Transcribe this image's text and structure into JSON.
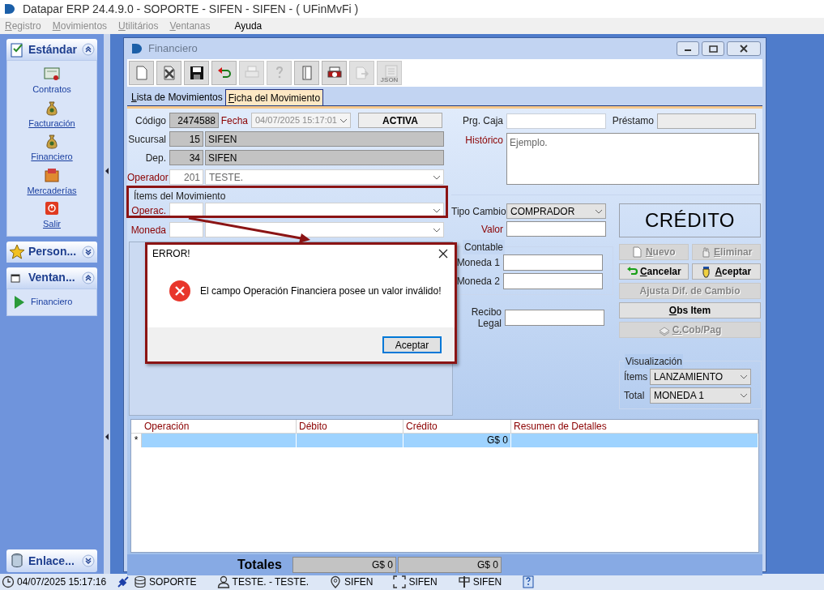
{
  "app_title": "Datapar ERP 24.4.9.0 - SOPORTE - SIFEN - SIFEN -  ( UFinMvFi )",
  "menu": [
    {
      "label": "Registro",
      "disabled": true
    },
    {
      "label": "Movimientos",
      "disabled": true
    },
    {
      "label": "Utilitários",
      "disabled": true
    },
    {
      "label": "Ventanas",
      "disabled": true
    },
    {
      "label": "Ayuda",
      "disabled": false
    }
  ],
  "sidebar": {
    "groups": [
      {
        "title": "Estándar",
        "expanded": true,
        "items": [
          {
            "label": "Contratos",
            "underlined": false
          },
          {
            "label": "Facturación",
            "underlined": true
          },
          {
            "label": "Financiero",
            "underlined": true
          },
          {
            "label": "Mercaderías",
            "underlined": true
          },
          {
            "label": "Salir",
            "underlined": true
          }
        ]
      },
      {
        "title": "Person...",
        "expanded": false
      },
      {
        "title": "Ventan...",
        "expanded": true,
        "items": [
          {
            "label": "Financiero",
            "underlined": false
          }
        ]
      }
    ],
    "bottom_group": {
      "title": "Enlace..."
    }
  },
  "window": {
    "title": "Financiero",
    "toolbar": [
      {
        "kind": "new",
        "disabled": false
      },
      {
        "kind": "delete",
        "disabled": false
      },
      {
        "kind": "save",
        "disabled": false
      },
      {
        "kind": "undo",
        "disabled": false
      },
      {
        "kind": "print",
        "disabled": true
      },
      {
        "kind": "help",
        "disabled": true
      },
      {
        "kind": "door",
        "disabled": false
      },
      {
        "kind": "print-cancel",
        "disabled": false
      },
      {
        "kind": "export",
        "disabled": true
      },
      {
        "kind": "json",
        "disabled": true,
        "label": "JSON"
      }
    ],
    "tabs": [
      {
        "label": "Lista de Movimientos",
        "selected": false
      },
      {
        "label": "Ficha del Movimiento",
        "selected": true
      }
    ],
    "form": {
      "codigo": {
        "label": "Código",
        "value": "2474588"
      },
      "fecha": {
        "label": "Fecha",
        "value": "04/07/2025 15:17:01",
        "disabled": true
      },
      "estado": "ACTIVA",
      "sucursal": {
        "label": "Sucursal",
        "code": "15",
        "name": "SIFEN"
      },
      "dep": {
        "label": "Dep.",
        "code": "34",
        "name": "SIFEN"
      },
      "operador": {
        "label": "Operador",
        "code": "201",
        "name": "TESTE."
      },
      "items_title": "Ítems del Movimiento",
      "operac": {
        "label": "Operac."
      },
      "moneda": {
        "label": "Moneda"
      },
      "prg_caja": {
        "label": "Prg. Caja"
      },
      "prestamo": {
        "label": "Préstamo"
      },
      "historico": {
        "label": "Histórico",
        "value": "Ejemplo."
      },
      "tipo_cambio": {
        "label": "Tipo Cambio",
        "value": "COMPRADOR"
      },
      "valor": {
        "label": "Valor"
      },
      "contable": {
        "title": "Contable",
        "fields": [
          {
            "label": "Moneda 1"
          },
          {
            "label": "Moneda 2"
          }
        ]
      },
      "recibo_legal": {
        "label": "Recibo Legal"
      },
      "tipo": "CRÉDITO",
      "buttons": [
        {
          "label": "Nuevo",
          "disabled": true,
          "accel": true,
          "wide": false
        },
        {
          "label": "Eliminar",
          "disabled": true,
          "accel": true,
          "wide": false
        },
        {
          "label": "Cancelar",
          "disabled": false,
          "accel": true,
          "wide": false
        },
        {
          "label": "Aceptar",
          "disabled": false,
          "accel": true,
          "wide": false
        },
        {
          "label": "Ajusta Dif. de Cambio",
          "disabled": true,
          "accel": false,
          "wide": true
        },
        {
          "label": "Obs Item",
          "disabled": false,
          "accel": true,
          "wide": true
        },
        {
          "label": "C.Cob/Pag",
          "disabled": true,
          "accel": true,
          "wide": true
        }
      ],
      "visualizacion": {
        "title": "Visualización",
        "fields": [
          {
            "label": "Ítems",
            "value": "LANZAMIENTO"
          },
          {
            "label": "Total",
            "value": "MONEDA 1"
          }
        ]
      }
    },
    "table": {
      "columns": [
        "Operación",
        "Débito",
        "Crédito",
        "Resumen de Detalles"
      ],
      "rows": [
        {
          "marker": "*",
          "cells": [
            "",
            "",
            "G$ 0",
            ""
          ],
          "selected": true
        }
      ]
    },
    "totals": {
      "label": "Totales",
      "values": [
        "G$ 0",
        "G$ 0"
      ]
    },
    "dialog": {
      "title": "ERROR!",
      "message": "El campo Operación Financiera posee un valor inválido!",
      "button": "Aceptar"
    }
  },
  "status_bar": [
    {
      "kind": "clock",
      "text": "04/07/2025 15:17:16"
    },
    {
      "kind": "plug"
    },
    {
      "kind": "database",
      "text": "SOPORTE"
    },
    {
      "kind": "user",
      "text": "TESTE. - TESTE."
    },
    {
      "kind": "pin",
      "text": "SIFEN"
    },
    {
      "kind": "brackets",
      "text": "SIFEN"
    },
    {
      "kind": "signpost",
      "text": "SIFEN"
    },
    {
      "kind": "help"
    }
  ]
}
